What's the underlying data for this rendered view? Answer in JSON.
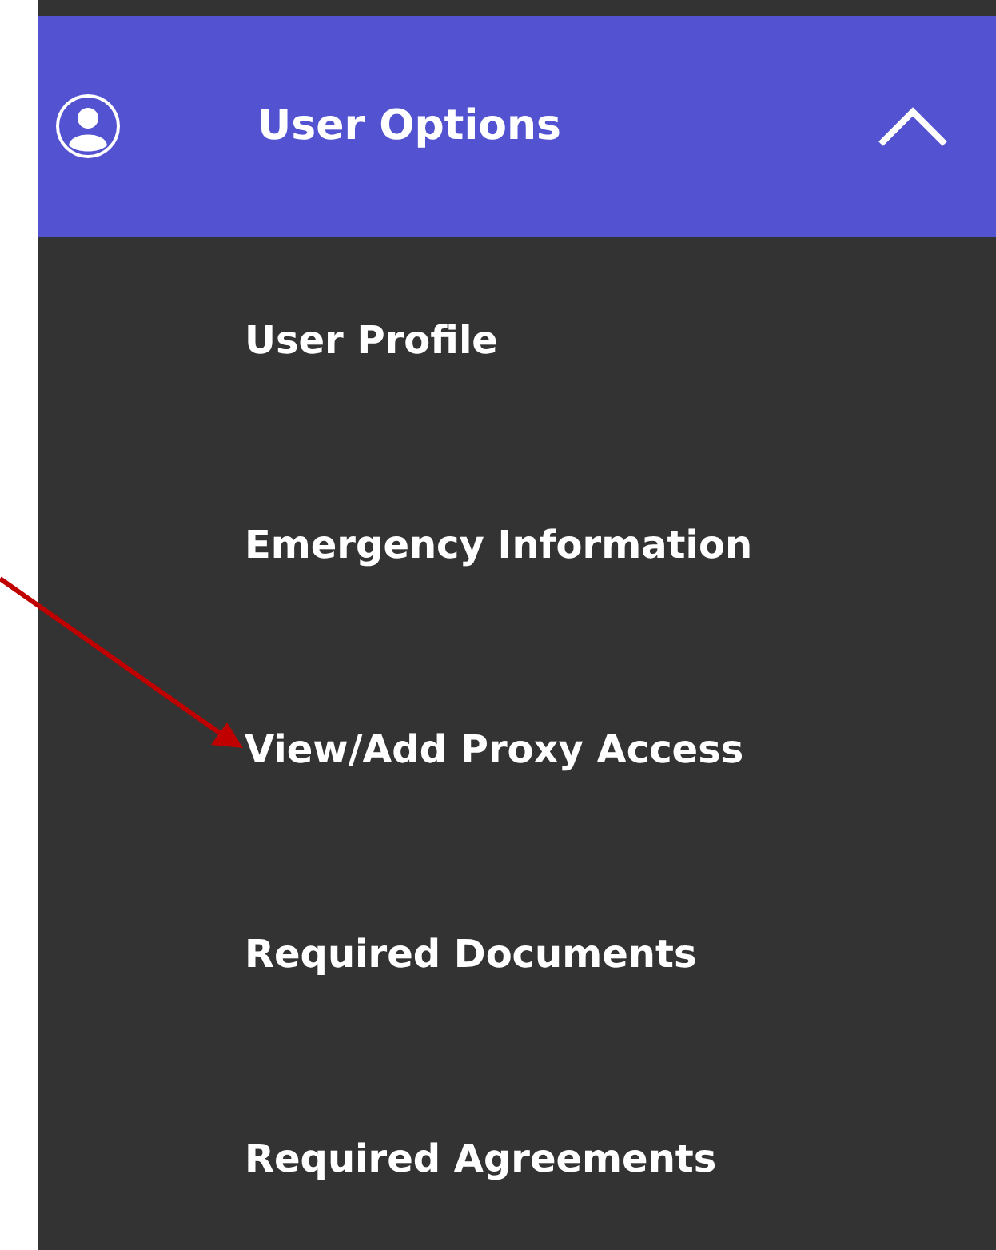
{
  "menu": {
    "title": "User Options",
    "expanded": true,
    "items": [
      {
        "label": "User Profile"
      },
      {
        "label": "Emergency Information"
      },
      {
        "label": "View/Add Proxy Access"
      },
      {
        "label": "Required Documents"
      },
      {
        "label": "Required Agreements"
      }
    ]
  }
}
